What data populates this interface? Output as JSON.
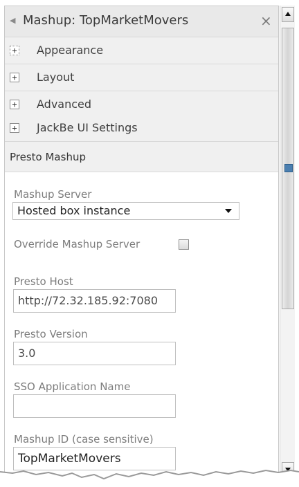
{
  "title_bar": {
    "collapse_icon": "collapse-arrow-icon",
    "title": "Mashup: TopMarketMovers",
    "close_icon": "close-icon",
    "close_glyph": "×"
  },
  "sections": [
    {
      "label": "Appearance",
      "icon": "expand-plus-icon",
      "glyph": "+"
    },
    {
      "label": "Layout",
      "icon": "expand-plus-icon",
      "glyph": "+"
    },
    {
      "label": "Advanced",
      "icon": "expand-plus-icon",
      "glyph": "+"
    },
    {
      "label": "JackBe UI Settings",
      "icon": "expand-plus-icon",
      "glyph": "+"
    }
  ],
  "presto": {
    "title": "Presto Mashup",
    "mashup_server": {
      "label": "Mashup Server",
      "selected": "Hosted box instance"
    },
    "override": {
      "label": "Override Mashup Server",
      "checked": false
    },
    "presto_host": {
      "label": "Presto Host",
      "value": "http://72.32.185.92:7080"
    },
    "presto_version": {
      "label": "Presto Version",
      "value": "3.0"
    },
    "sso_app": {
      "label": "SSO Application Name",
      "value": ""
    },
    "mashup_id": {
      "label": "Mashup ID (case sensitive)",
      "value": "TopMarketMovers"
    }
  },
  "colors": {
    "header_bg": "#e9e9e9",
    "section_bg": "#f0f0f0",
    "label_gray": "#7d7d7d",
    "scroll_grip": "#4b7fb0"
  }
}
